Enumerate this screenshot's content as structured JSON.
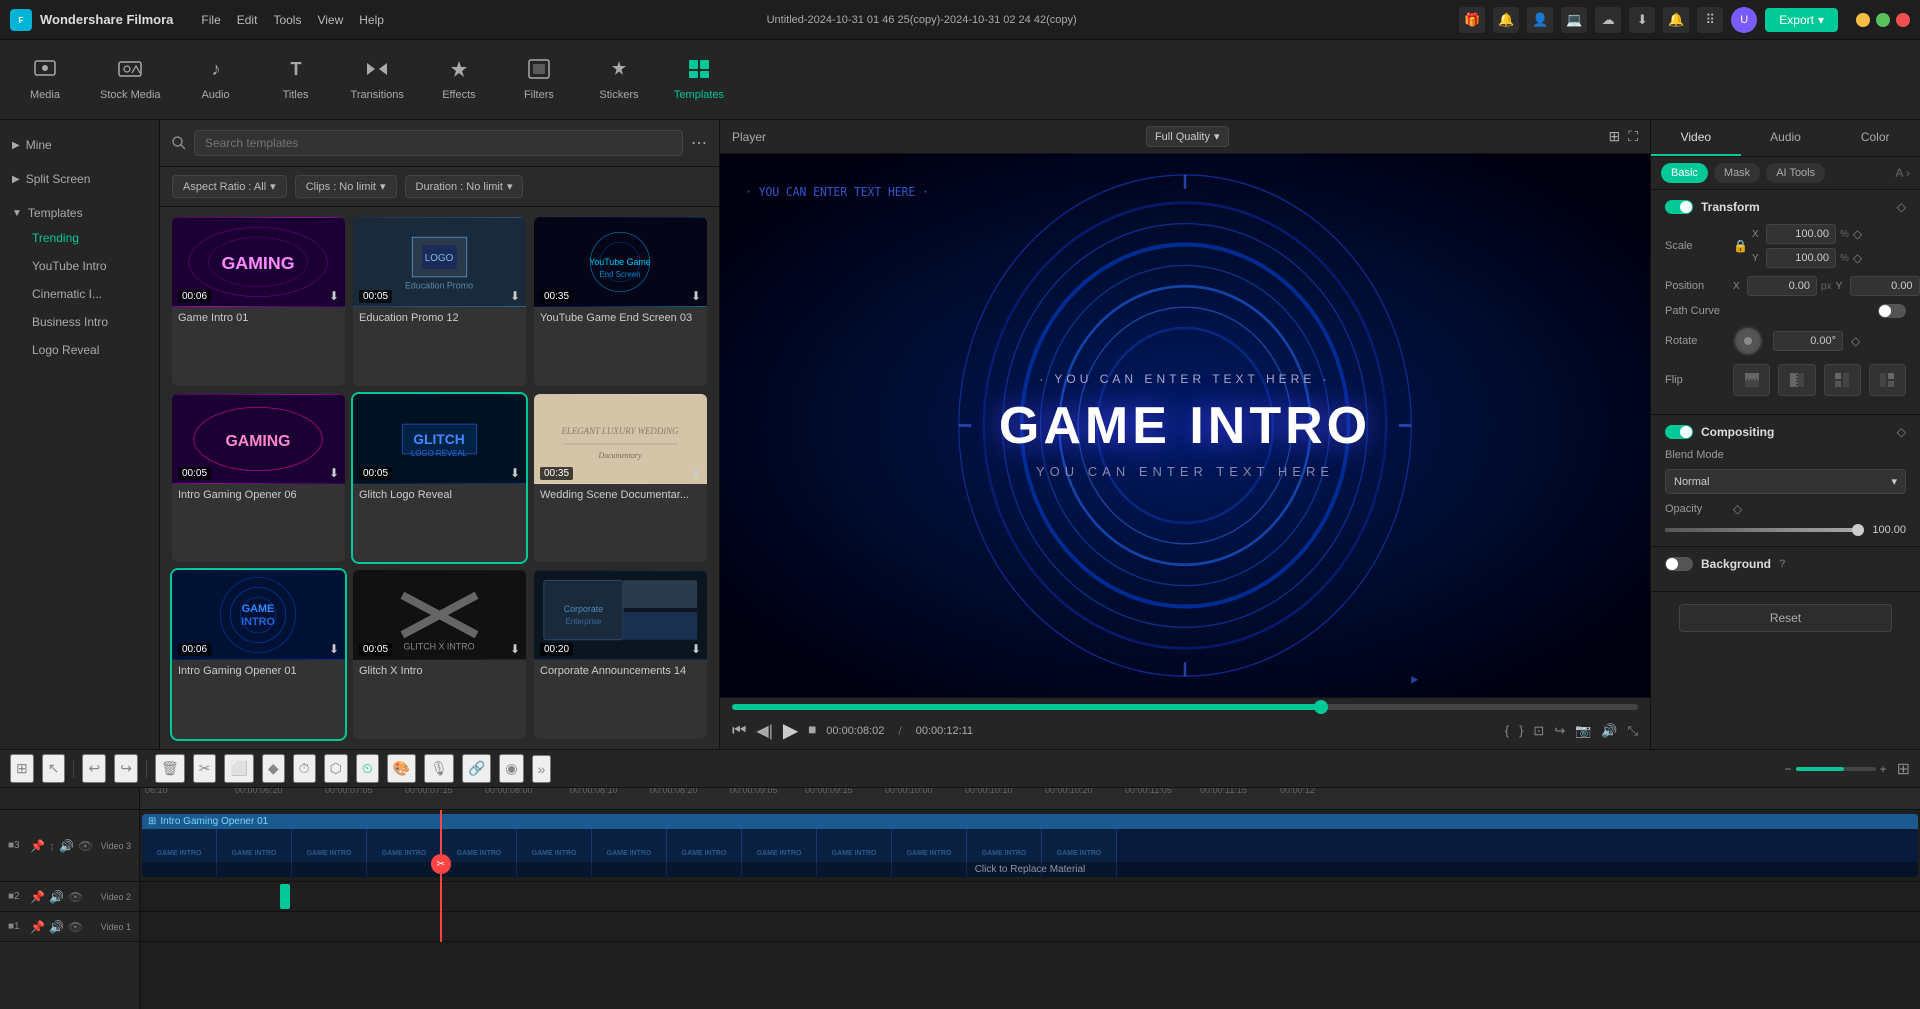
{
  "titlebar": {
    "app_name": "Wondershare Filmora",
    "logo_text": "WF",
    "menu": [
      "File",
      "Edit",
      "Tools",
      "View",
      "Help"
    ],
    "title": "Untitled-2024-10-31 01 46 25(copy)-2024-10-31 02 24 42(copy)",
    "export_label": "Export",
    "win_controls": [
      "minimize",
      "maximize",
      "close"
    ]
  },
  "toolbar": {
    "items": [
      {
        "id": "media",
        "label": "Media",
        "icon": "🎬"
      },
      {
        "id": "stock",
        "label": "Stock Media",
        "icon": "📷"
      },
      {
        "id": "audio",
        "label": "Audio",
        "icon": "🎵"
      },
      {
        "id": "titles",
        "label": "Titles",
        "icon": "T"
      },
      {
        "id": "transitions",
        "label": "Transitions",
        "icon": "⟷"
      },
      {
        "id": "effects",
        "label": "Effects",
        "icon": "✨"
      },
      {
        "id": "filters",
        "label": "Filters",
        "icon": "🔲"
      },
      {
        "id": "stickers",
        "label": "Stickers",
        "icon": "⭐"
      },
      {
        "id": "templates",
        "label": "Templates",
        "icon": "▦",
        "active": true
      }
    ]
  },
  "sidebar": {
    "sections": [
      {
        "id": "mine",
        "label": "Mine",
        "expanded": false
      },
      {
        "id": "split-screen",
        "label": "Split Screen",
        "expanded": false
      },
      {
        "id": "templates",
        "label": "Templates",
        "expanded": true,
        "items": [
          "Trending",
          "YouTube Intro",
          "Cinematic I...",
          "Business Intro",
          "Logo Reveal"
        ]
      }
    ]
  },
  "templates_panel": {
    "search_placeholder": "Search templates",
    "filters": [
      {
        "id": "aspect",
        "label": "Aspect Ratio : All"
      },
      {
        "id": "clips",
        "label": "Clips : No limit"
      },
      {
        "id": "duration",
        "label": "Duration : No limit"
      }
    ],
    "templates": [
      {
        "id": "game-intro-01",
        "name": "Game Intro 01",
        "duration": "00:06",
        "thumb_class": "thumb-gaming",
        "thumb_text": "GAMING"
      },
      {
        "id": "education-promo-12",
        "name": "Education Promo 12",
        "duration": "00:05",
        "thumb_class": "thumb-education",
        "thumb_text": "LOGO"
      },
      {
        "id": "youtube-game-end-03",
        "name": "YouTube Game End Screen 03",
        "duration": "00:35",
        "thumb_class": "thumb-youtube-game",
        "thumb_text": ""
      },
      {
        "id": "intro-gaming-opener-06",
        "name": "Intro Gaming Opener 06",
        "duration": "00:05",
        "thumb_class": "thumb-gaming",
        "thumb_text": "GAMING"
      },
      {
        "id": "glitch-logo-reveal",
        "name": "Glitch Logo Reveal",
        "duration": "00:05",
        "thumb_class": "thumb-glitch",
        "thumb_text": "GLITCH",
        "selected": true
      },
      {
        "id": "wedding-scene",
        "name": "Wedding Scene Documentar...",
        "duration": "00:35",
        "thumb_class": "thumb-wedding",
        "thumb_text": ""
      },
      {
        "id": "intro-gaming-opener-01",
        "name": "Intro Gaming Opener 01",
        "duration": "00:06",
        "thumb_class": "thumb-game-intro2",
        "thumb_text": "GAME INTRO",
        "selected": true
      },
      {
        "id": "glitch-x-intro",
        "name": "Glitch X Intro",
        "duration": "00:05",
        "thumb_class": "thumb-glitch-x",
        "thumb_text": "✕"
      },
      {
        "id": "corporate-announcements-14",
        "name": "Corporate Announcements 14",
        "duration": "00:20",
        "thumb_class": "thumb-corporate",
        "thumb_text": ""
      }
    ]
  },
  "player": {
    "label": "Player",
    "quality": "Full Quality",
    "current_time": "00:00:08:02",
    "total_time": "00:00:12:11",
    "progress_percent": 65,
    "game_intro": {
      "line1": "· YOU CAN ENTER TEXT HERE ·",
      "title": "GAME INTRO",
      "subtitle": "YOU CAN ENTER TEXT HERE"
    }
  },
  "right_panel": {
    "tabs": [
      "Video",
      "Audio",
      "Color"
    ],
    "active_tab": "Video",
    "sub_tabs": [
      "Basic",
      "Mask",
      "AI Tools"
    ],
    "active_sub_tab": "Basic",
    "sections": {
      "transform": {
        "label": "Transform",
        "enabled": true,
        "scale": {
          "x": "100.00",
          "y": "100.00",
          "unit": "%"
        },
        "position": {
          "x": "0.00",
          "y": "0.00",
          "unit": "px"
        },
        "path_curve": {
          "label": "Path Curve",
          "enabled": false
        },
        "rotate": {
          "label": "Rotate",
          "value": "0.00°"
        },
        "flip": {
          "label": "Flip",
          "buttons": [
            "↑↓",
            "↔",
            "⬛↔",
            "↔⬛"
          ]
        }
      },
      "compositing": {
        "label": "Compositing",
        "enabled": true,
        "blend_mode": {
          "label": "Blend Mode",
          "value": "Normal"
        },
        "opacity": {
          "label": "Opacity",
          "value": "100.00"
        }
      },
      "background": {
        "label": "Background",
        "enabled": false
      }
    },
    "reset_label": "Reset"
  },
  "timeline": {
    "toolbar_buttons": [
      "grid",
      "select",
      "undo",
      "redo",
      "delete",
      "split",
      "crop",
      "keyframe",
      "speed",
      "mask",
      "stabilize",
      "timer",
      "color",
      "volume",
      "audio-sync",
      "expand"
    ],
    "tracks": [
      {
        "id": "video3",
        "label": "Video 3",
        "num": 3,
        "type": "video"
      },
      {
        "id": "video2",
        "label": "Video 2",
        "num": 2,
        "type": "small"
      },
      {
        "id": "video1",
        "label": "Video 1",
        "num": 1,
        "type": "small"
      }
    ],
    "ruler_marks": [
      "06:10",
      "00:00:06:20",
      "00:00:07:05",
      "00:00:07:15",
      "00:00:08:00",
      "00:00:08:10",
      "00:00:08:20",
      "00:00:09:05",
      "00:00:09:15",
      "00:00:10:00",
      "00:00:10:10",
      "00:00:10:20",
      "00:00:11:05",
      "00:00:11:15",
      "00:00:12"
    ],
    "clip": {
      "label": "Intro Gaming Opener 01",
      "replace_text": "Click to Replace Material",
      "frame_label": "GAME INTRO"
    }
  }
}
